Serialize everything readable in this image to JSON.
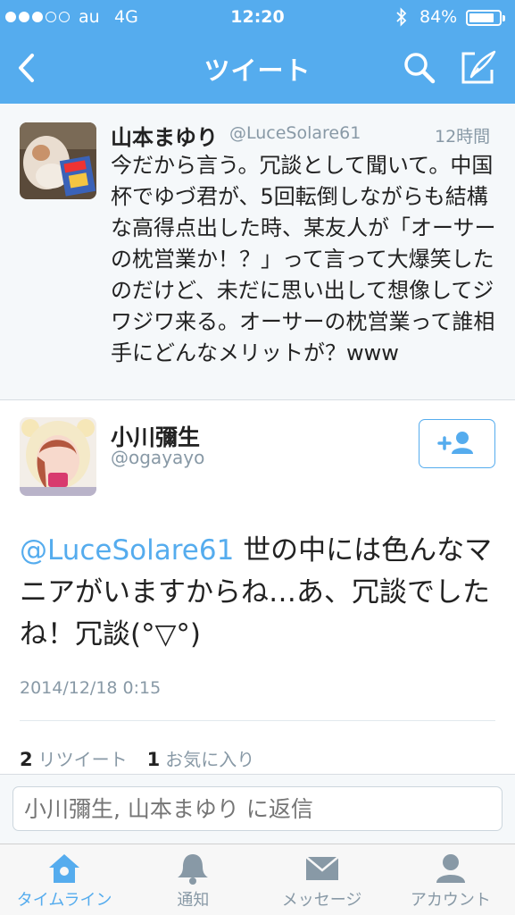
{
  "status_bar": {
    "carrier": "au",
    "network": "4G",
    "time": "12:20",
    "battery": "84%",
    "battery_level": 0.84
  },
  "nav": {
    "title": "ツイート",
    "back_icon": "chevron-left-icon",
    "search_icon": "search-icon",
    "compose_icon": "compose-icon"
  },
  "original_tweet": {
    "name": "山本まゆり",
    "handle": "@LuceSolare61",
    "time": "12時間",
    "text": "今だから言う。冗談として聞いて。中国杯でゆづ君が、5回転倒しながらも結構な高得点出した時、某友人が「オーサーの枕営業か！？」って言って大爆笑したのだけど、未だに思い出して想像してジワジワ来る。オーサーの枕営業って誰相手にどんなメリットが？www"
  },
  "reply_tweet": {
    "name": "小川彌生",
    "handle": "@ogayayo",
    "mention": "@LuceSolare61",
    "text": "世の中には色んなマニアがいますからね…あ、冗談でしたね！冗談(°▽°)",
    "date": "2014/12/18 0:15",
    "retweet_count": "2",
    "retweet_label": "リツイート",
    "favorite_count": "1",
    "favorite_label": "お気に入り"
  },
  "reply_box": {
    "placeholder": "小川彌生, 山本まゆり に返信"
  },
  "tabs": [
    {
      "label": "タイムライン",
      "icon": "home-icon",
      "active": true
    },
    {
      "label": "通知",
      "icon": "bell-icon",
      "active": false
    },
    {
      "label": "メッセージ",
      "icon": "envelope-icon",
      "active": false
    },
    {
      "label": "アカウント",
      "icon": "person-icon",
      "active": false
    }
  ],
  "colors": {
    "brand": "#55acee",
    "text": "#222222",
    "muted": "#8899a6"
  }
}
